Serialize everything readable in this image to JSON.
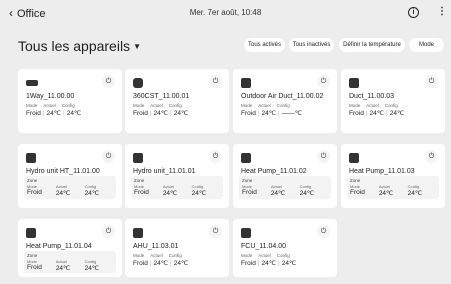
{
  "header": {
    "back_label": "Office",
    "datetime": "Mer. 7er août, 10:48"
  },
  "page": {
    "title": "Tous les appareils"
  },
  "filters": [
    "Tous activés",
    "Tous inactivés",
    "Définir la température",
    "Mode"
  ],
  "labels": {
    "mode": "Mode",
    "current": "Actuel",
    "config": "Config",
    "zone": "Zone"
  },
  "devices": [
    {
      "name": "1Way_11.00.00",
      "mode": "Froid",
      "current": "24℃",
      "config": "24℃",
      "icon": "cassette-icon"
    },
    {
      "name": "360CST_11.00.01",
      "mode": "Froid",
      "current": "24℃",
      "config": "24℃",
      "icon": "round-cassette-icon"
    },
    {
      "name": "Outdoor Air Duct_11.00.02",
      "mode": "Froid",
      "current": "24℃",
      "config": "——℃",
      "icon": "duct-icon"
    },
    {
      "name": "Duct_11.00.03",
      "mode": "Froid",
      "current": "24℃",
      "config": "24℃",
      "icon": "duct-icon"
    },
    {
      "name": "Hydro unit HT_11.01.00",
      "mode": "Froid",
      "current": "24℃",
      "config": "24℃",
      "icon": "hydro-unit-icon"
    },
    {
      "name": "Hydro unit_11.01.01",
      "mode": "Froid",
      "current": "24℃",
      "config": "24℃",
      "icon": "hydro-unit-icon"
    },
    {
      "name": "Heat Pump_11.01.02",
      "mode": "Froid",
      "current": "24℃",
      "config": "24℃",
      "icon": "heat-pump-icon"
    },
    {
      "name": "Heat Pump_11.01.03",
      "mode": "Froid",
      "current": "24℃",
      "config": "24℃",
      "icon": "heat-pump-icon"
    },
    {
      "name": "Heat Pump_11.01.04",
      "mode": "Froid",
      "current": "24℃",
      "config": "24℃",
      "icon": "heat-pump-icon"
    },
    {
      "name": "AHU_11.03.01",
      "mode": "Froid",
      "current": "24℃",
      "config": "24℃",
      "icon": "ahu-icon"
    },
    {
      "name": "FCU_11.04.00",
      "mode": "Froid",
      "current": "24℃",
      "config": "24℃",
      "icon": "fcu-icon"
    }
  ]
}
